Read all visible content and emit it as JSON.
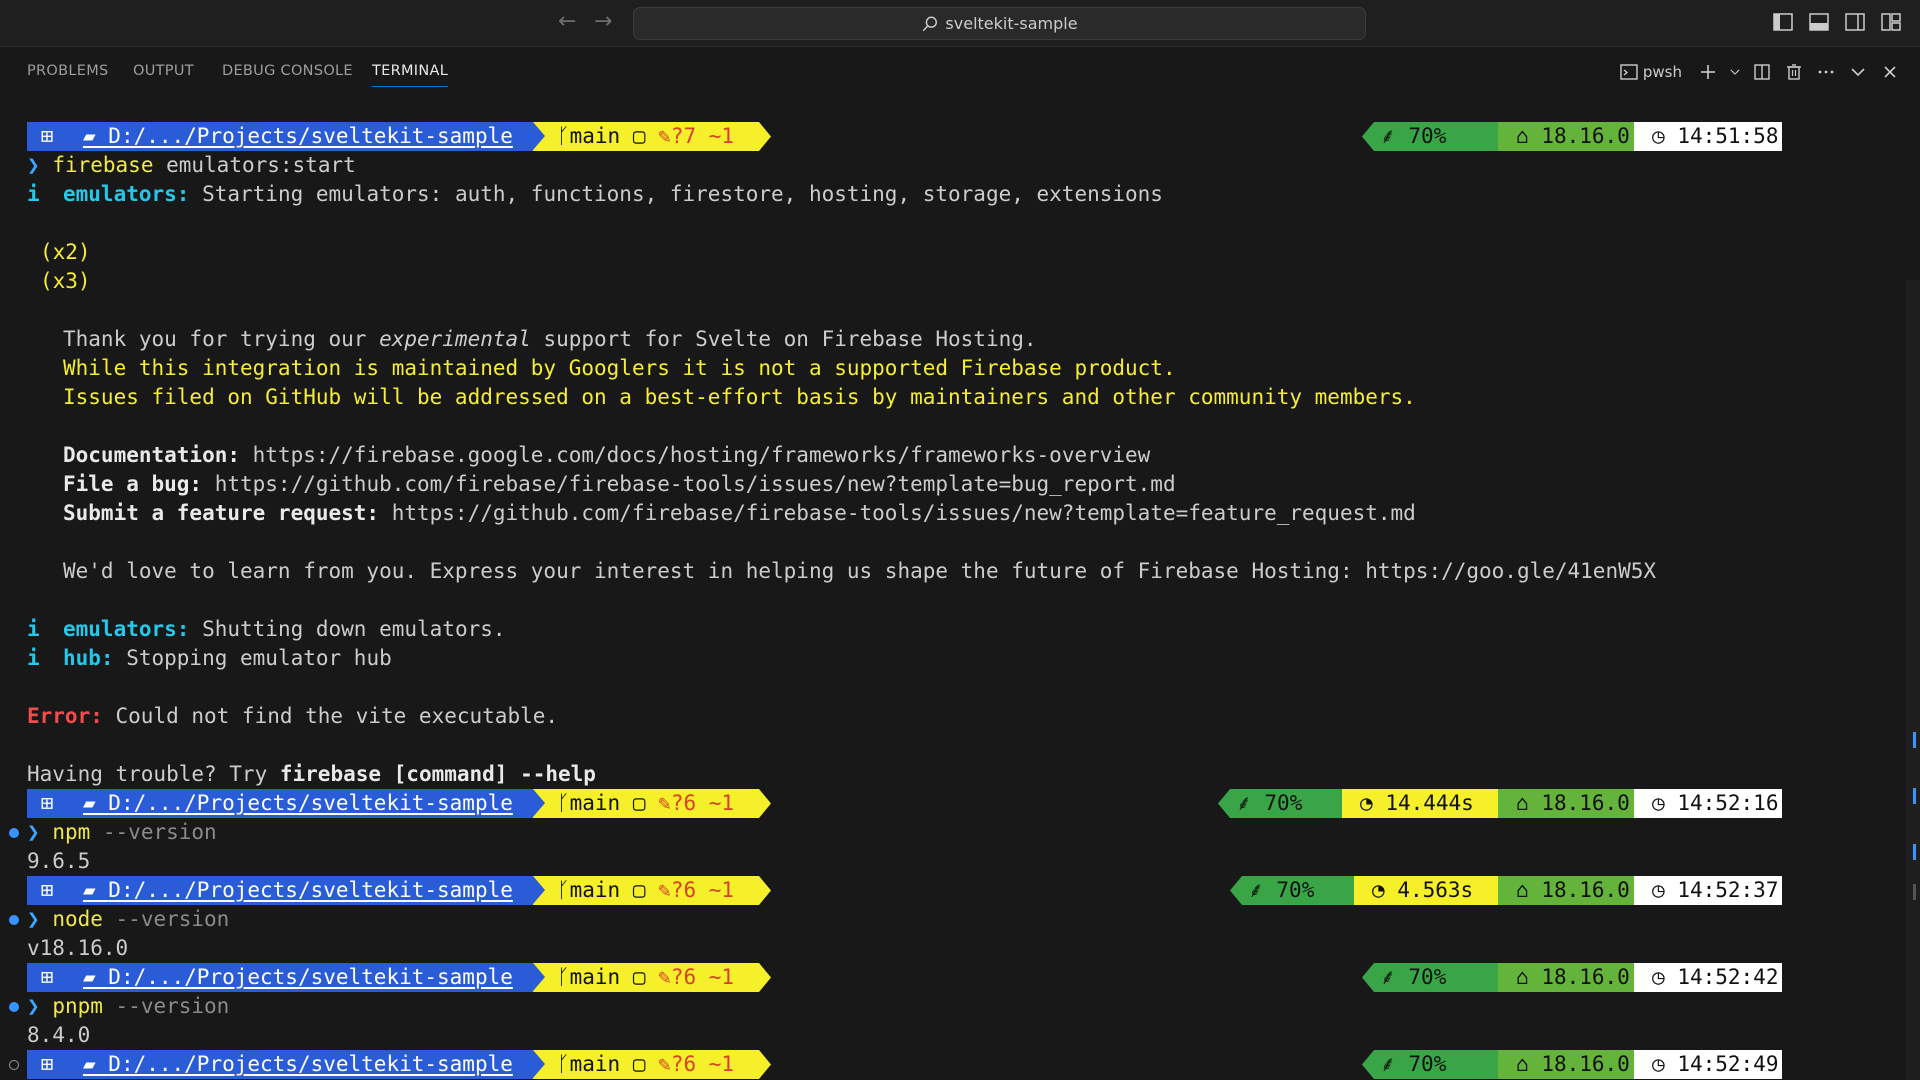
{
  "titlebar": {
    "search_text": "sveltekit-sample",
    "back_icon": "arrow-left-icon",
    "forward_icon": "arrow-right-icon"
  },
  "panel": {
    "tabs": [
      {
        "label": "PROBLEMS",
        "active": false
      },
      {
        "label": "OUTPUT",
        "active": false
      },
      {
        "label": "DEBUG CONSOLE",
        "active": false
      },
      {
        "label": "TERMINAL",
        "active": true
      }
    ],
    "shell_label": "pwsh"
  },
  "colors": {
    "path_segment": "#2a5cd8",
    "git_segment": "#f5f02a",
    "node_segment": "#64b33a",
    "battery_segment": "#3aa546",
    "accent": "#0078d4"
  },
  "prompt": {
    "path": "D:/.../Projects/sveltekit-sample",
    "branch": "main",
    "os_icon": "windows-icon",
    "folder_icon": "folder-icon",
    "branch_icon": "git-branch-icon",
    "copy_icon": "copy-icon",
    "edit_icon": "edit-icon",
    "battery": "70%",
    "node_version": "18.16.0",
    "prompt_char": "❯"
  },
  "prompts": [
    {
      "changes": "?7 ~1",
      "duration": "",
      "time": "14:51:58"
    },
    {
      "changes": "?6 ~1",
      "duration": "14.444s",
      "time": "14:52:16"
    },
    {
      "changes": "?6 ~1",
      "duration": "4.563s",
      "time": "14:52:37"
    },
    {
      "changes": "?6 ~1",
      "duration": "",
      "time": "14:52:42"
    },
    {
      "changes": "?6 ~1",
      "duration": "",
      "time": "14:52:49"
    }
  ],
  "output": {
    "cmd1_name": "firebase",
    "cmd1_args": " emulators:start",
    "info_i": "i",
    "emulators_label": "emulators:",
    "starting": " Starting emulators: auth, functions, firestore, hosting, storage, extensions",
    "x2": "(x2)",
    "x3": "(x3)",
    "thanks_pre": "Thank you for trying our ",
    "thanks_em": "experimental",
    "thanks_post": " support for Svelte on Firebase Hosting.",
    "maintained": "While this integration is maintained by Googlers it is not a supported Firebase product.",
    "issues": "Issues filed on GitHub will be addressed on a best-effort basis by maintainers and other community members.",
    "doc_label": "Documentation:",
    "doc_url": " https://firebase.google.com/docs/hosting/frameworks/frameworks-overview",
    "bug_label": "File a bug:",
    "bug_url": " https://github.com/firebase/firebase-tools/issues/new?template=bug_report.md",
    "feat_label": "Submit a feature request:",
    "feat_url": " https://github.com/firebase/firebase-tools/issues/new?template=feature_request.md",
    "love": "We'd love to learn from you. Express your interest in helping us shape the future of Firebase Hosting: https://goo.gle/41enW5X",
    "shutting": " Shutting down emulators.",
    "hub_label": "hub:",
    "stopping": " Stopping emulator hub",
    "error_label": "Error:",
    "error_msg": " Could not find the vite executable.",
    "trouble_pre": "Having trouble? Try ",
    "trouble_cmd": "firebase [command] --help",
    "cmd2_name": "npm",
    "cmd2_args": " --version",
    "npm_ver": "9.6.5",
    "cmd3_name": "node",
    "cmd3_args": " --version",
    "node_ver": "v18.16.0",
    "cmd4_name": "pnpm",
    "cmd4_args": " --version",
    "pnpm_ver": "8.4.0"
  }
}
